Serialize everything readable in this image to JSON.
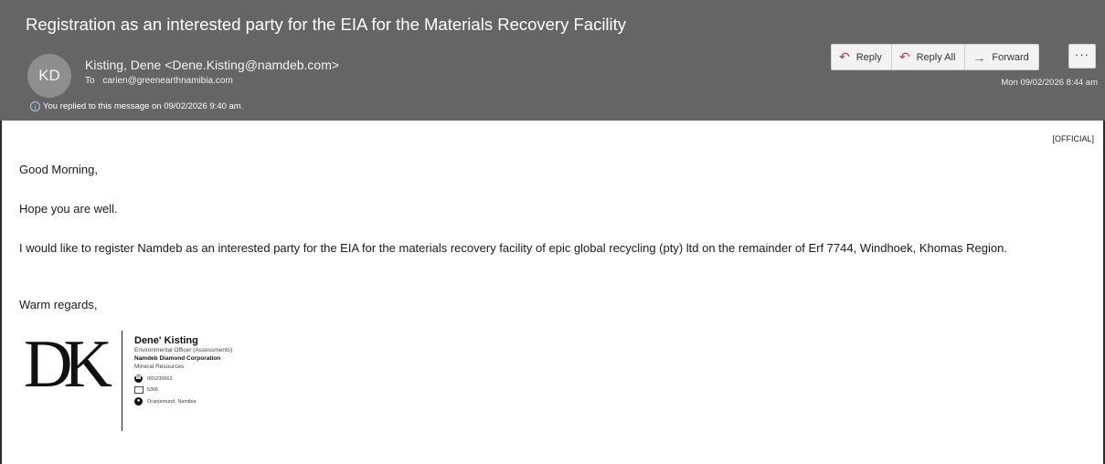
{
  "email": {
    "subject": "Registration as an interested party for the EIA for the Materials Recovery Facility",
    "sender": {
      "initials": "KD",
      "display": "Kisting, Dene <Dene.Kisting@namdeb.com>"
    },
    "to_label": "To",
    "to_address": "carien@greenearthnamibia.com",
    "replied_notice": "You replied to this message on 09/02/2026 9:40 am.",
    "date": "Mon 09/02/2026 8:44 am",
    "actions": {
      "reply": "Reply",
      "reply_all": "Reply All",
      "forward": "Forward",
      "more": "···"
    },
    "icons": {
      "reply": "reply-arrow-icon",
      "reply_all": "reply-all-arrow-icon",
      "forward": "forward-arrow-icon",
      "info": "info-icon"
    },
    "classification": "[OFFICIAL]",
    "body": {
      "greeting": "Good Morning,",
      "line1": "Hope you are well.",
      "line2": "I would like to register Namdeb as an interested party for the EIA for the materials recovery facility of epic global recycling (pty) ltd on the remainder of Erf 7744, Windhoek, Khomas Region.",
      "closing": "Warm regards,"
    },
    "signature": {
      "logo": "DK",
      "name": "Dene' Kisting",
      "title": "Environmental Officer (Assessments)",
      "company": "Namdeb Diamond Corporation",
      "division": "Mineral Resources",
      "phone": "065239663",
      "office": "5306",
      "location": "Oranjemund, Namibia"
    }
  },
  "colors": {
    "header_bg": "#656565",
    "reply_accent": "#c4314b",
    "forward_accent": "#2b6cb0"
  }
}
